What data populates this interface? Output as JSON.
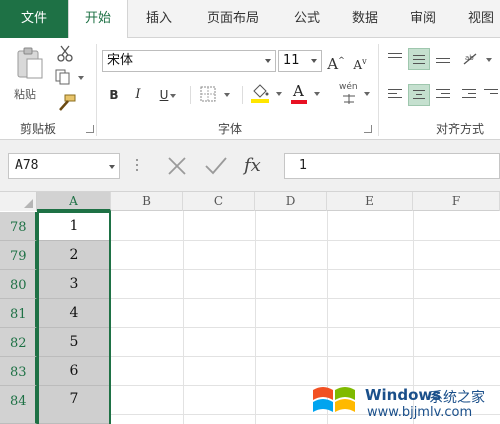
{
  "tabs": [
    "文件",
    "开始",
    "插入",
    "页面布局",
    "公式",
    "数据",
    "审阅",
    "视图"
  ],
  "ribbon": {
    "clipboard": {
      "paste_label": "粘贴",
      "group_label": "剪贴板"
    },
    "font": {
      "family": "宋体",
      "size": "11",
      "bold": "B",
      "italic": "I",
      "underline": "U",
      "font_color_glyph": "A",
      "grow_glyph": "A",
      "shrink_glyph": "A",
      "phonetic_glyph": "wén",
      "group_label": "字体"
    },
    "alignment": {
      "group_label": "对齐方式"
    },
    "accent_color": "#1e7145"
  },
  "formula_bar": {
    "name_box": "A78",
    "fx_label": "fx",
    "value": "1"
  },
  "grid": {
    "columns": [
      "A",
      "B",
      "C",
      "D",
      "E",
      "F"
    ],
    "selected_column": "A",
    "rows": [
      {
        "num": "78",
        "a": "1"
      },
      {
        "num": "79",
        "a": "2"
      },
      {
        "num": "80",
        "a": "3"
      },
      {
        "num": "81",
        "a": "4"
      },
      {
        "num": "82",
        "a": "5"
      },
      {
        "num": "83",
        "a": "6"
      },
      {
        "num": "84",
        "a": "7"
      }
    ]
  },
  "watermark": {
    "brand": "Windows",
    "suffix": "系统之家",
    "url": "www.bjjmlv.com"
  }
}
